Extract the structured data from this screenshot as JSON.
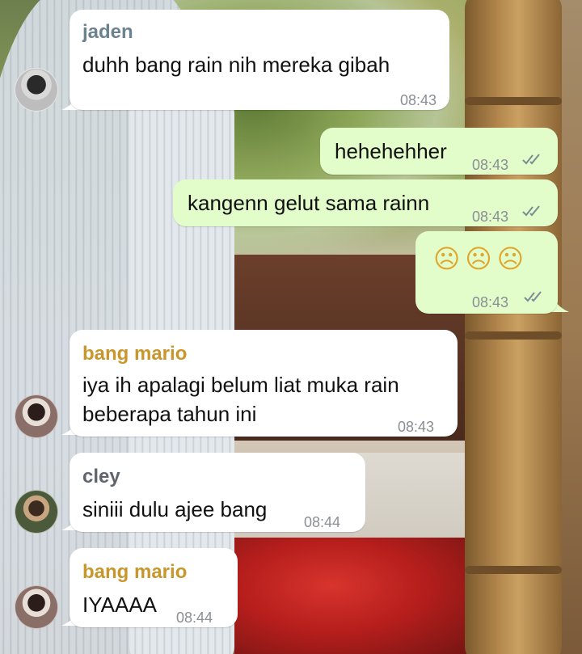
{
  "colors": {
    "incoming_bubble": "#ffffff",
    "outgoing_bubble": "#e2fcca",
    "name_jaden": "#6b8290",
    "name_mario": "#c8962b",
    "name_cley": "#5f666b",
    "timestamp": "#8a8f94",
    "read_ticks": "#7f8a93"
  },
  "messages": [
    {
      "direction": "in",
      "sender": "jaden",
      "text": "duhh bang rain nih mereka gibah",
      "time": "08:43",
      "avatar": "jaden-avatar"
    },
    {
      "direction": "out",
      "text": "hehehehher",
      "time": "08:43",
      "status": "read"
    },
    {
      "direction": "out",
      "text": "kangenn gelut sama rainn",
      "time": "08:43",
      "status": "read"
    },
    {
      "direction": "out",
      "text": "☹☹☹",
      "time": "08:43",
      "status": "read"
    },
    {
      "direction": "in",
      "sender": "bang mario",
      "text_lines": [
        "iya ih apalagi belum liat muka rain",
        "beberapa tahun ini"
      ],
      "time": "08:43",
      "avatar": "mario-avatar"
    },
    {
      "direction": "in",
      "sender": "cley",
      "text": "siniii dulu ajee bang",
      "time": "08:44",
      "avatar": "cley-avatar"
    },
    {
      "direction": "in",
      "sender": "bang mario",
      "text": "IYAAAA",
      "time": "08:44",
      "avatar": "mario-avatar"
    }
  ],
  "icons": {
    "read_status": "double-check-icon",
    "avatar": "user-avatar-icon"
  }
}
